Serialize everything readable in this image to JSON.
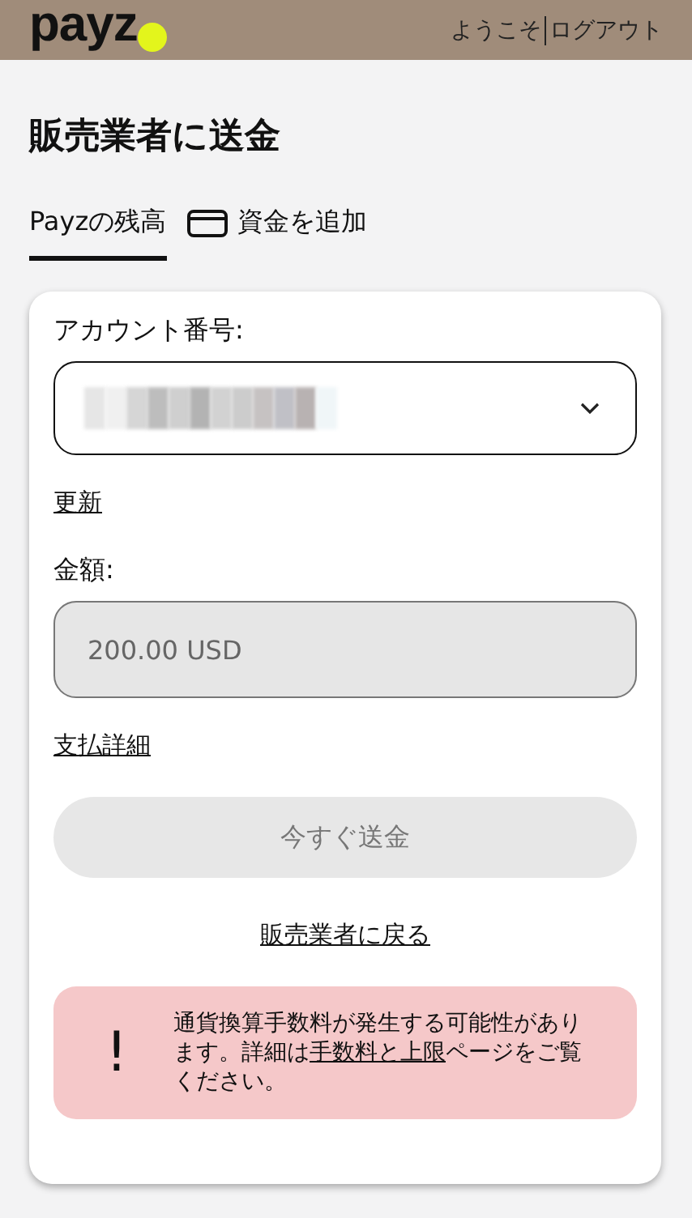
{
  "header": {
    "logo": "payz",
    "welcome": "ようこそ",
    "logout": "ログアウト"
  },
  "title": "販売業者に送金",
  "tabs": [
    {
      "label": "Payzの残高",
      "selected": true,
      "kind": "plain"
    },
    {
      "label": "資金を追加",
      "selected": false,
      "kind": "card"
    }
  ],
  "form": {
    "account_label": "アカウント番号:",
    "refresh_link": "更新",
    "amount_label": "金額:",
    "amount_value": "200.00 USD",
    "amount_disabled": true,
    "details_link": "支払詳細",
    "send_button": "今すぐ送金",
    "send_disabled": true,
    "back_link": "販売業者に戻る"
  },
  "notice": {
    "icon": "!",
    "text_before": "通貨換算手数料が発生する可能性があります。詳細は",
    "link": "手数料と上限",
    "text_after": "ページをご覧ください。"
  }
}
